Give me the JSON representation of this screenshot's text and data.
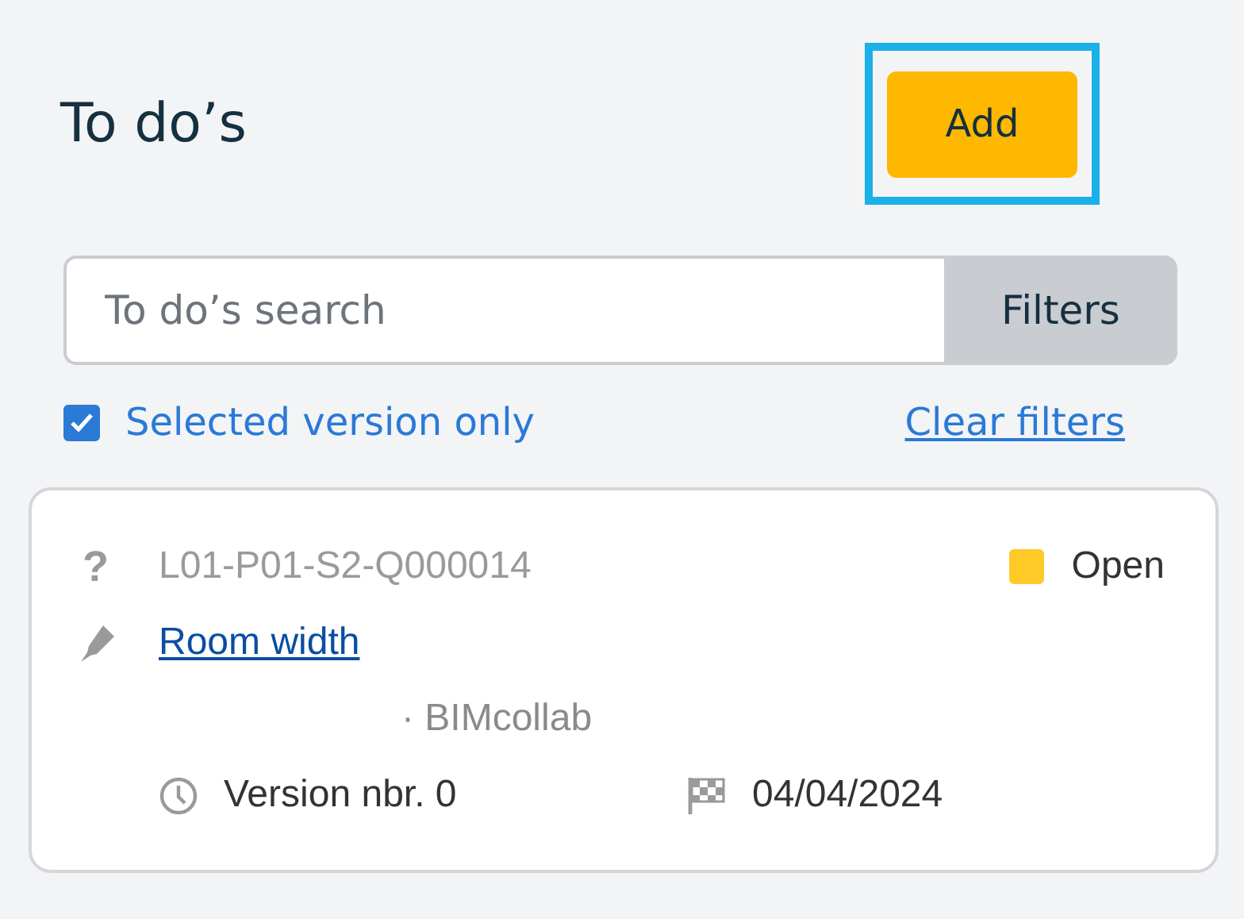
{
  "header": {
    "title": "To do’s",
    "add_button": {
      "label": "Add",
      "highlighted": true
    }
  },
  "search": {
    "placeholder": "To do’s search",
    "filters_button": "Filters"
  },
  "filter_options": {
    "selected_version_only": {
      "label": "Selected version only",
      "checked": true
    },
    "clear_filters": "Clear filters"
  },
  "todos": [
    {
      "type_icon": "?",
      "id": "L01-P01-S2-Q000014",
      "status": {
        "label": "Open",
        "color": "#ffc928"
      },
      "title": "Room width",
      "meta": "· BIMcollab",
      "version": "Version nbr. 0",
      "due_date": "04/04/2024"
    }
  ]
}
